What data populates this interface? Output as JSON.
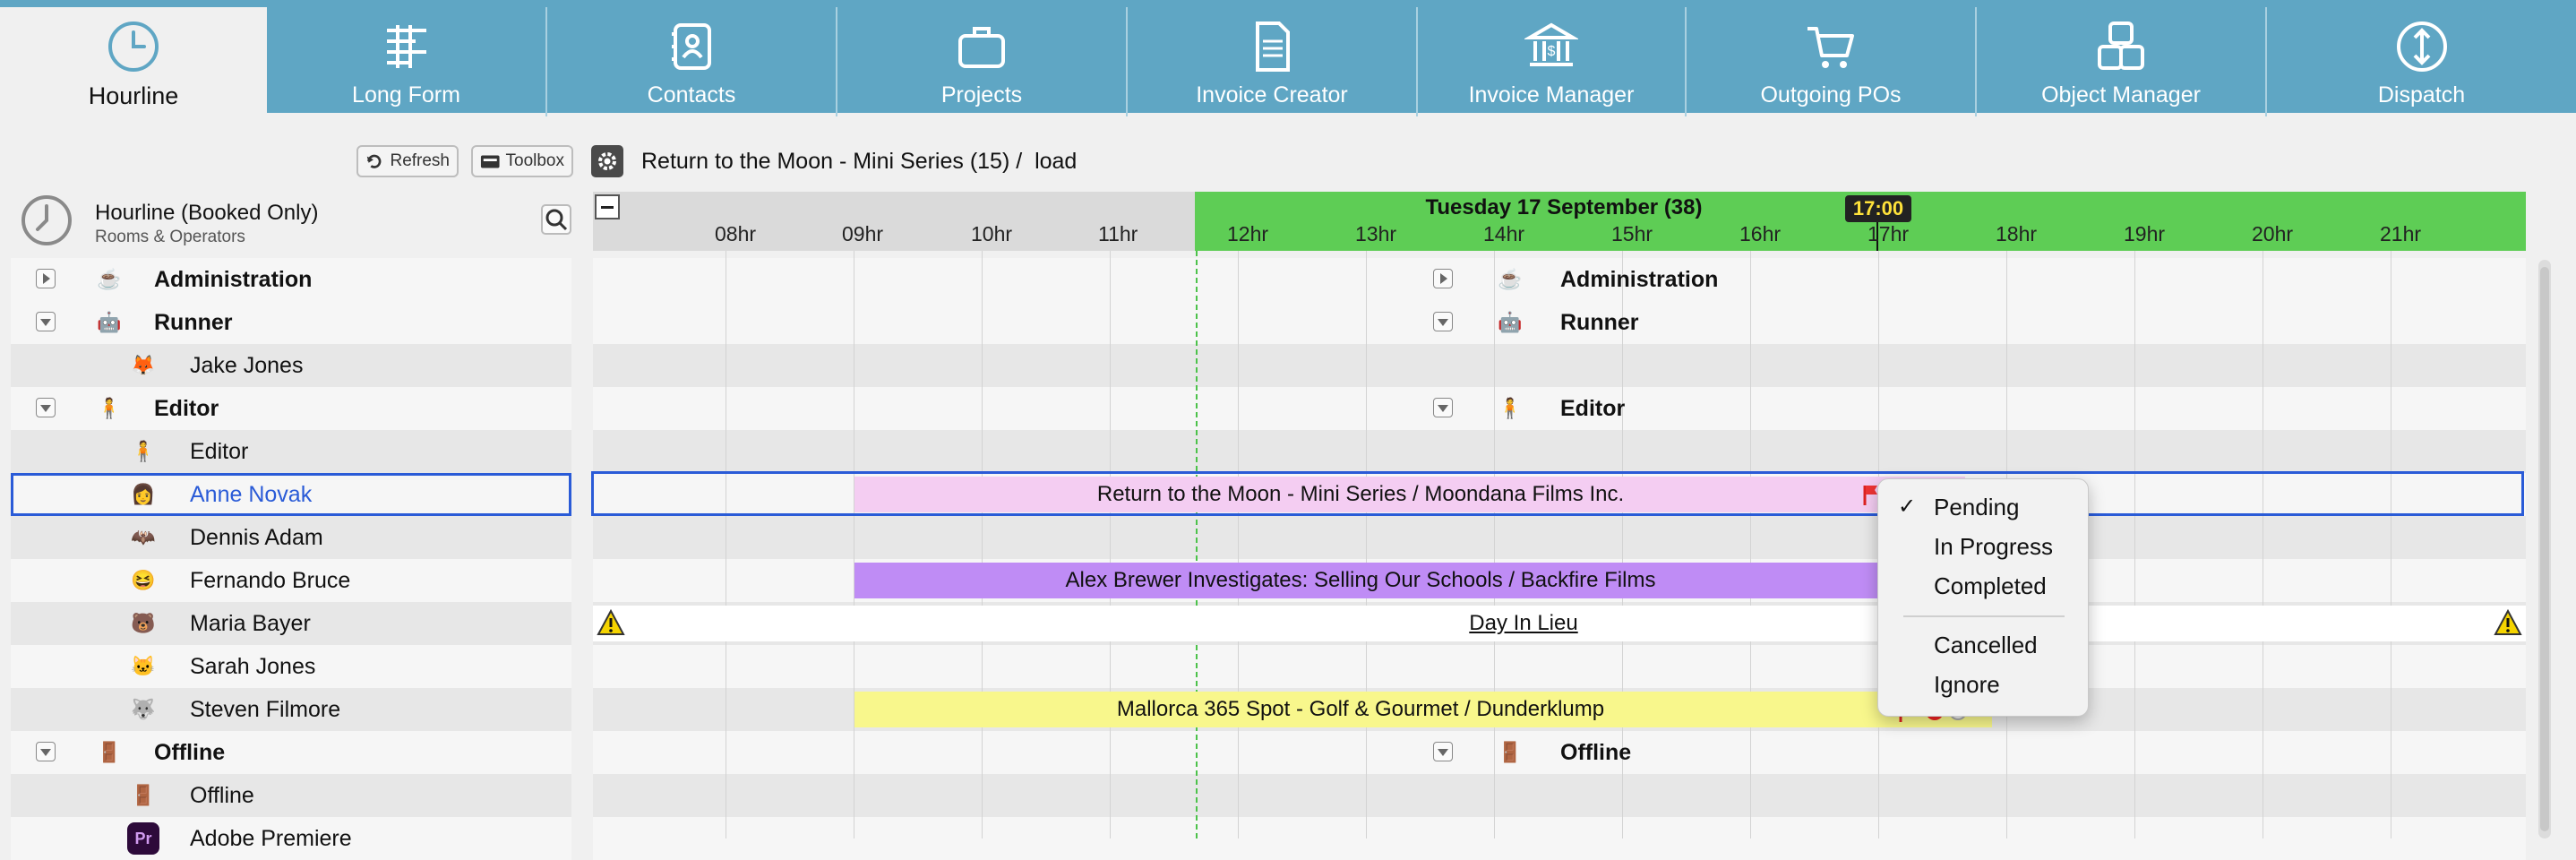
{
  "tabs": [
    {
      "label": "Hourline",
      "icon": "clock-icon",
      "active": true
    },
    {
      "label": "Long Form",
      "icon": "long-form-icon"
    },
    {
      "label": "Contacts",
      "icon": "contacts-icon"
    },
    {
      "label": "Projects",
      "icon": "briefcase-icon"
    },
    {
      "label": "Invoice Creator",
      "icon": "invoice-document-icon"
    },
    {
      "label": "Invoice Manager",
      "icon": "bank-icon"
    },
    {
      "label": "Outgoing POs",
      "icon": "cart-icon"
    },
    {
      "label": "Object Manager",
      "icon": "cubes-icon"
    },
    {
      "label": "Dispatch",
      "icon": "dispatch-arrows-icon"
    }
  ],
  "toolbar": {
    "refresh_label": "Refresh",
    "toolbox_label": "Toolbox",
    "breadcrumb": "Return to the Moon - Mini Series (15) /  load"
  },
  "panel": {
    "title": "Hourline (Booked Only)",
    "subtitle": "Rooms & Operators"
  },
  "timeline": {
    "date_label": "Tuesday 17 September (38)",
    "current_time": "17:00",
    "hours": [
      "08hr",
      "09hr",
      "10hr",
      "11hr",
      "12hr",
      "13hr",
      "14hr",
      "15hr",
      "16hr",
      "17hr",
      "18hr",
      "19hr",
      "20hr",
      "21hr"
    ]
  },
  "rows": [
    {
      "label": "Administration",
      "type": "group",
      "collapsed": true,
      "avatar": "☕"
    },
    {
      "label": "Runner",
      "type": "group",
      "collapsed": false,
      "avatar": "🤖"
    },
    {
      "label": "Jake Jones",
      "type": "person",
      "avatar": "🦊"
    },
    {
      "label": "Editor",
      "type": "group",
      "collapsed": false,
      "avatar": "🧍"
    },
    {
      "label": "Editor",
      "type": "person",
      "avatar": "🧍"
    },
    {
      "label": "Anne Novak",
      "type": "person",
      "avatar": "👩",
      "selected": true
    },
    {
      "label": "Dennis Adam",
      "type": "person",
      "avatar": "🦇"
    },
    {
      "label": "Fernando Bruce",
      "type": "person",
      "avatar": "😆"
    },
    {
      "label": "Maria Bayer",
      "type": "person",
      "avatar": "🐻"
    },
    {
      "label": "Sarah Jones",
      "type": "person",
      "avatar": "🐱"
    },
    {
      "label": "Steven Filmore",
      "type": "person",
      "avatar": "🐺"
    },
    {
      "label": "Offline",
      "type": "group",
      "collapsed": false,
      "avatar": "🚪"
    },
    {
      "label": "Offline",
      "type": "person",
      "avatar": "🚪"
    },
    {
      "label": "Adobe Premiere",
      "type": "person",
      "avatar": "Pr"
    }
  ],
  "group_labels": {
    "administration": "Administration",
    "runner": "Runner",
    "editor": "Editor",
    "offline": "Offline"
  },
  "bookings": {
    "anne": "Return to the Moon - Mini Series / Moondana Films Inc.",
    "fernando": "Alex Brewer Investigates: Selling Our Schools / Backfire Films",
    "maria": "Day In Lieu",
    "steven": "Mallorca 365 Spot - Golf & Gourmet / Dunderklump"
  },
  "status_menu": {
    "items": [
      "Pending",
      "In Progress",
      "Completed",
      "Cancelled",
      "Ignore"
    ],
    "checked": "Pending"
  },
  "colors": {
    "tab_bg": "#5fa6c4",
    "timeline_green": "#5ecd55",
    "anne_booking": "#f4cdf2",
    "fernando_booking": "#bf8cf5",
    "steven_booking": "#f8f78c",
    "selection": "#2a5bd7"
  }
}
